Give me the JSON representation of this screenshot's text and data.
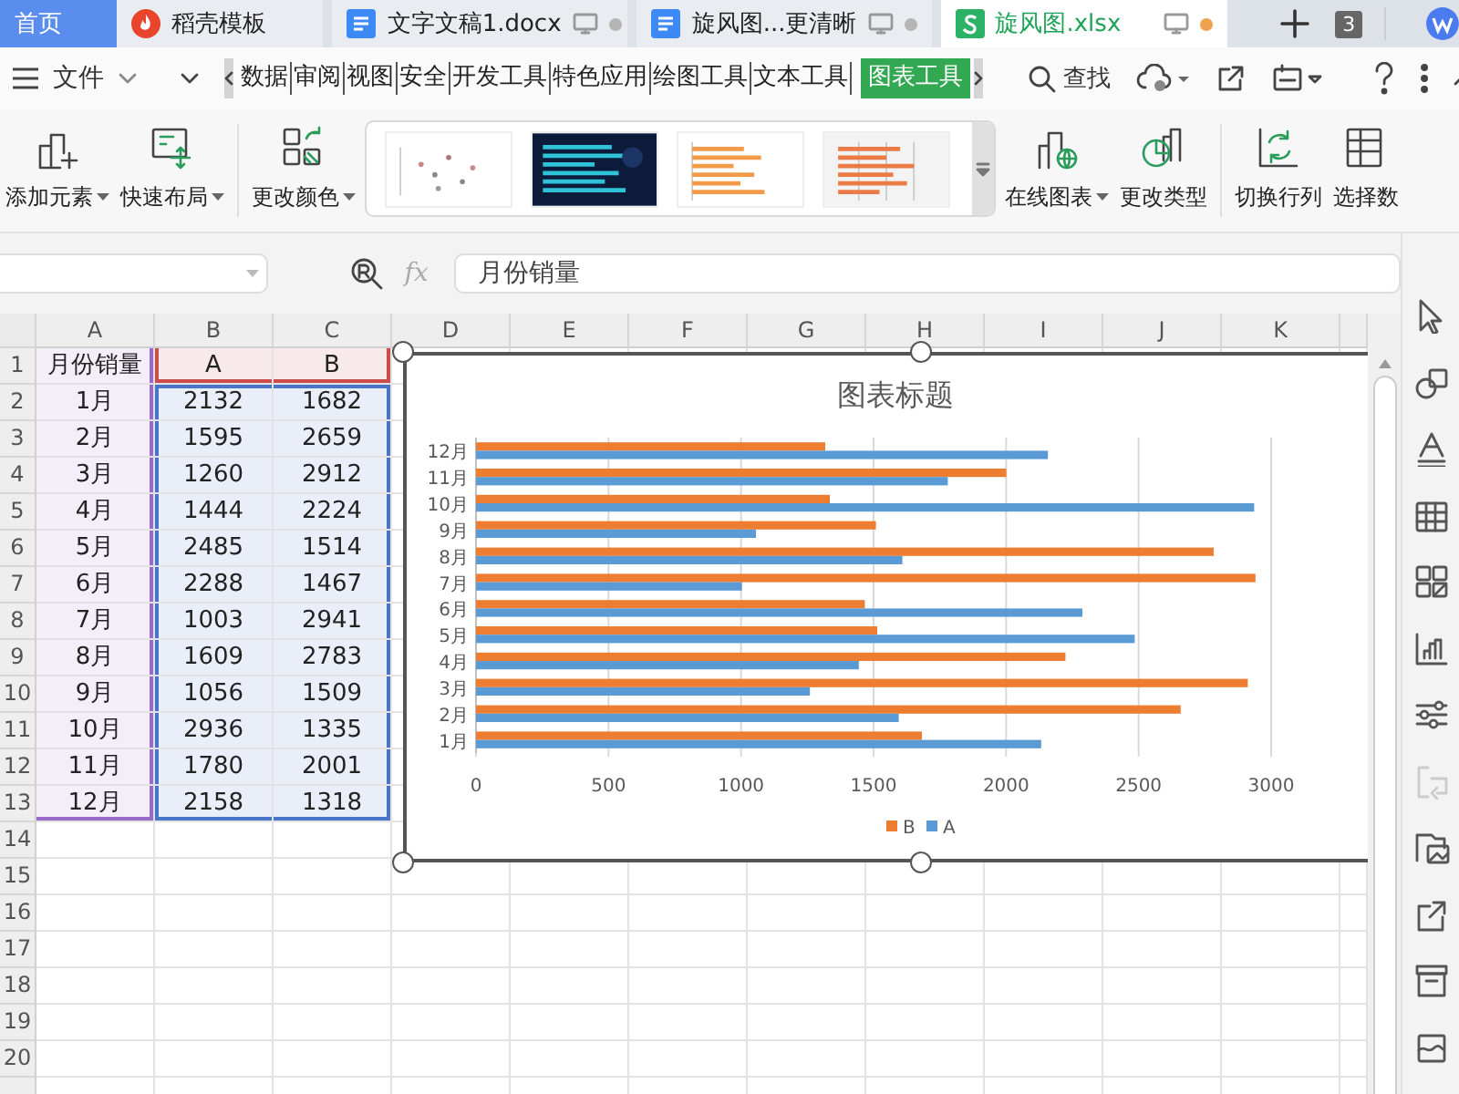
{
  "tabs": [
    {
      "label": "首页",
      "kind": "home",
      "selected": false
    },
    {
      "label": "稻壳模板",
      "kind": "template",
      "selected": false
    },
    {
      "label": "文字文稿1.docx",
      "kind": "writer",
      "selected": false,
      "modified": false
    },
    {
      "label": "旋风图...更清晰",
      "kind": "writer",
      "selected": false,
      "modified": false
    },
    {
      "label": "旋风图.xlsx",
      "kind": "sheet",
      "selected": true,
      "modified": true
    }
  ],
  "tab_count": "3",
  "menu": {
    "file": "文件",
    "search": "查找",
    "tabs": [
      {
        "label": "数据",
        "selected": false
      },
      {
        "label": "审阅",
        "selected": false
      },
      {
        "label": "视图",
        "selected": false
      },
      {
        "label": "安全",
        "selected": false
      },
      {
        "label": "开发工具",
        "selected": false
      },
      {
        "label": "特色应用",
        "selected": false
      },
      {
        "label": "绘图工具",
        "selected": false
      },
      {
        "label": "文本工具",
        "selected": false
      },
      {
        "label": "图表工具",
        "selected": true
      }
    ]
  },
  "ribbon": [
    {
      "kind": "add-element",
      "label": "添加元素",
      "dropdown": true
    },
    {
      "kind": "layout",
      "label": "快速布局",
      "dropdown": true
    },
    {
      "kind": "separator"
    },
    {
      "kind": "color",
      "label": "更改颜色",
      "dropdown": true
    },
    {
      "kind": "gallery",
      "items": [
        {
          "kind": "scatter-light"
        },
        {
          "kind": "bars-dark"
        },
        {
          "kind": "bars-orange"
        },
        {
          "kind": "bars-grid"
        }
      ]
    },
    {
      "kind": "online-chart",
      "label": "在线图表",
      "dropdown": true
    },
    {
      "kind": "change-type",
      "label": "更改类型",
      "dropdown": false
    },
    {
      "kind": "separator"
    },
    {
      "kind": "switch",
      "label": "切换行列",
      "dropdown": false
    },
    {
      "kind": "select-data",
      "label": "选择数",
      "dropdown": false
    }
  ],
  "formula_bar": {
    "fx": "fx",
    "formula": "月份销量"
  },
  "sheet": {
    "columns": [
      "A",
      "B",
      "C",
      "D",
      "E",
      "F",
      "G",
      "H",
      "I",
      "J",
      "K"
    ],
    "row_numbers": [
      "1",
      "2",
      "3",
      "4",
      "5",
      "6",
      "7",
      "8",
      "9",
      "10",
      "11",
      "12",
      "13",
      "14",
      "15",
      "16",
      "17",
      "18",
      "19",
      "20"
    ],
    "cells": [
      [
        "月份销量",
        "A",
        "B"
      ],
      [
        "1月",
        "2132",
        "1682"
      ],
      [
        "2月",
        "1595",
        "2659"
      ],
      [
        "3月",
        "1260",
        "2912"
      ],
      [
        "4月",
        "1444",
        "2224"
      ],
      [
        "5月",
        "2485",
        "1514"
      ],
      [
        "6月",
        "2288",
        "1467"
      ],
      [
        "7月",
        "1003",
        "2941"
      ],
      [
        "8月",
        "1609",
        "2783"
      ],
      [
        "9月",
        "1056",
        "1509"
      ],
      [
        "10月",
        "2936",
        "1335"
      ],
      [
        "11月",
        "1780",
        "2001"
      ],
      [
        "12月",
        "2158",
        "1318"
      ]
    ]
  },
  "chart": {
    "selected": true,
    "chart_data": {
      "type": "bar",
      "orientation": "horizontal",
      "title": "图表标题",
      "categories": [
        "12月",
        "11月",
        "10月",
        "9月",
        "8月",
        "7月",
        "6月",
        "5月",
        "4月",
        "3月",
        "2月",
        "1月"
      ],
      "series": [
        {
          "name": "B",
          "color": "#ed7d31",
          "values": [
            1318,
            2001,
            1335,
            1509,
            2783,
            2941,
            1467,
            1514,
            2224,
            2912,
            2659,
            1682
          ]
        },
        {
          "name": "A",
          "color": "#5b9bd5",
          "values": [
            2158,
            1780,
            2936,
            1056,
            1609,
            1003,
            2288,
            2485,
            1444,
            1260,
            1595,
            2132
          ]
        }
      ],
      "xlim": [
        0,
        3000
      ],
      "xticks": [
        0,
        500,
        1000,
        1500,
        2000,
        2500,
        3000
      ],
      "grid": true,
      "legend": true
    }
  },
  "side_tools": [
    {
      "kind": "select",
      "disabled": false
    },
    {
      "kind": "shapes",
      "disabled": false
    },
    {
      "kind": "text-style",
      "disabled": false
    },
    {
      "kind": "table",
      "disabled": false
    },
    {
      "kind": "grid",
      "disabled": false
    },
    {
      "kind": "chart",
      "disabled": false
    },
    {
      "kind": "sliders",
      "disabled": false
    },
    {
      "kind": "swap",
      "disabled": true
    },
    {
      "kind": "image",
      "disabled": false
    },
    {
      "kind": "share",
      "disabled": false
    },
    {
      "kind": "archive",
      "disabled": false
    },
    {
      "kind": "frame",
      "disabled": false
    }
  ]
}
